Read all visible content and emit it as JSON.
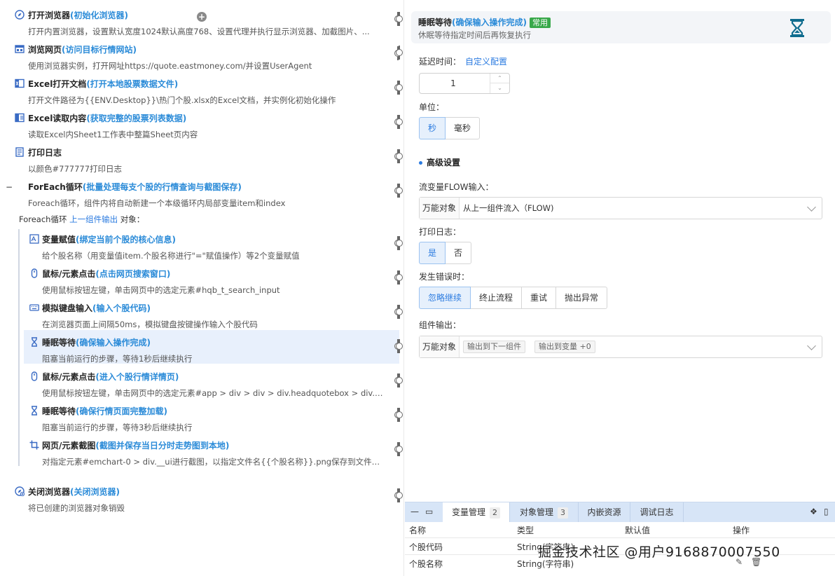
{
  "steps": [
    {
      "id": "open-browser",
      "title": "打开浏览器",
      "note": "(初始化浏览器)",
      "desc": "打开内置浏览器，设置默认宽度1024默认高度768、设置代理并执行显示浏览器、加截图片、...",
      "icon": "compass-icon"
    },
    {
      "id": "browse-page",
      "title": "浏览网页",
      "note": "(访问目标行情网站)",
      "desc": "使用浏览器实例，打开网址https://quote.eastmoney.com/并设置UserAgent",
      "icon": "browser-window-icon"
    },
    {
      "id": "excel-open",
      "title": "Excel打开文档",
      "note": "(打开本地股票数据文件)",
      "desc": "打开文件路径为{{ENV.Desktop}}\\热门个股.xlsx的Excel文档，并实例化初始化操作",
      "icon": "excel-icon"
    },
    {
      "id": "excel-read",
      "title": "Excel读取内容",
      "note": "(获取完整的股票列表数据)",
      "desc": "读取Excel内Sheet1工作表中整篇Sheet页内容",
      "icon": "excel-read-icon"
    },
    {
      "id": "print-log",
      "title": "打印日志",
      "note": "",
      "desc": "以颜色#777777打印日志",
      "icon": "log-icon"
    },
    {
      "id": "foreach",
      "title": "ForEach循环",
      "note": "(批量处理每支个股的行情查询与截图保存)",
      "desc": "Foreach循环，组件内将自动新建一个本级循环内局部变量item和index",
      "icon": "loop-icon"
    }
  ],
  "loop_label": {
    "prefix": "Foreach循环",
    "link": "上一组件输出",
    "suffix": "对象："
  },
  "sub_steps": [
    {
      "id": "assign",
      "title": "变量赋值",
      "note": "(绑定当前个股的核心信息)",
      "desc": "给个股名称（用变量值item.个股名称进行\"=\"赋值操作）等2个变量赋值",
      "icon": "assign-icon"
    },
    {
      "id": "click1",
      "title": "鼠标/元素点击",
      "note": "(点击网页搜索窗口)",
      "desc": "使用鼠标按钮左键，单击网页中的选定元素#hqb_t_search_input",
      "icon": "mouse-icon"
    },
    {
      "id": "keyboard",
      "title": "模拟键盘输入",
      "note": "(输入个股代码)",
      "desc": "在浏览器页面上间隔50ms，模拟键盘按键操作输入个股代码",
      "icon": "keyboard-icon"
    },
    {
      "id": "sleep1",
      "title": "睡眠等待",
      "note": "(确保输入操作完成)",
      "desc": "阻塞当前运行的步骤，等待1秒后继续执行",
      "icon": "hourglass-icon",
      "active": true
    },
    {
      "id": "click2",
      "title": "鼠标/元素点击",
      "note": "(进入个股行情详情页)",
      "desc": "使用鼠标按钮左键，单击网页中的选定元素#app > div > div > div.headquotebox > div.hqb...",
      "icon": "mouse-icon"
    },
    {
      "id": "sleep2",
      "title": "睡眠等待",
      "note": "(确保行情页面完整加载)",
      "desc": "阻塞当前运行的步骤，等待3秒后继续执行",
      "icon": "hourglass-icon"
    },
    {
      "id": "screenshot",
      "title": "网页/元素截图",
      "note": "(截图并保存当日分时走势图到本地)",
      "desc": "对指定元素#emchart-0 > div.__ui进行截图，以指定文件名{{个股名称}}.png保存到文件夹{{...",
      "icon": "crop-icon"
    }
  ],
  "close_step": {
    "id": "close-browser",
    "title": "关闭浏览器",
    "note": "(关闭浏览器)",
    "desc": "将已创建的浏览器对象销毁",
    "icon": "close-browser-icon"
  },
  "detail": {
    "title": "睡眠等待",
    "note": "(确保输入操作完成)",
    "badge": "常用",
    "desc": "休眠等待指定时间后再恢复执行",
    "delay_label": "延迟时间：",
    "delay_link": "自定义配置",
    "delay_value": "1",
    "unit_label": "单位：",
    "units": [
      "秒",
      "毫秒"
    ],
    "unit_selected": 0,
    "advanced": "高级设置",
    "flow_label": "流变量FLOW输入：",
    "flow_tag": "万能对象",
    "flow_value": "从上一组件流入（FLOW)",
    "log_label": "打印日志：",
    "log_options": [
      "是",
      "否"
    ],
    "log_selected": 0,
    "error_label": "发生错误时：",
    "error_options": [
      "忽略继续",
      "终止流程",
      "重试",
      "抛出异常"
    ],
    "error_selected": 0,
    "output_label": "组件输出：",
    "output_tag": "万能对象",
    "output_pills": [
      "输出到下一组件",
      "输出到变量 +0"
    ]
  },
  "bottom": {
    "tabs": [
      {
        "label": "变量管理",
        "count": "2"
      },
      {
        "label": "对象管理",
        "count": "3"
      },
      {
        "label": "内嵌资源",
        "count": ""
      },
      {
        "label": "调试日志",
        "count": ""
      }
    ],
    "columns": [
      "名称",
      "类型",
      "默认值",
      "操作"
    ],
    "rows": [
      {
        "name": "个股代码",
        "type": "String(字符串)",
        "default": ""
      },
      {
        "name": "个股名称",
        "type": "String(字符串)",
        "default": ""
      }
    ],
    "watermark": "掘金技术社区 @用户9168870007550"
  },
  "colors": {
    "accent": "#2b7be0",
    "note": "#2b8bd8",
    "badge": "#38a84a",
    "active_row": "#e8f0fc",
    "tabbar": "#d7e5f7"
  }
}
